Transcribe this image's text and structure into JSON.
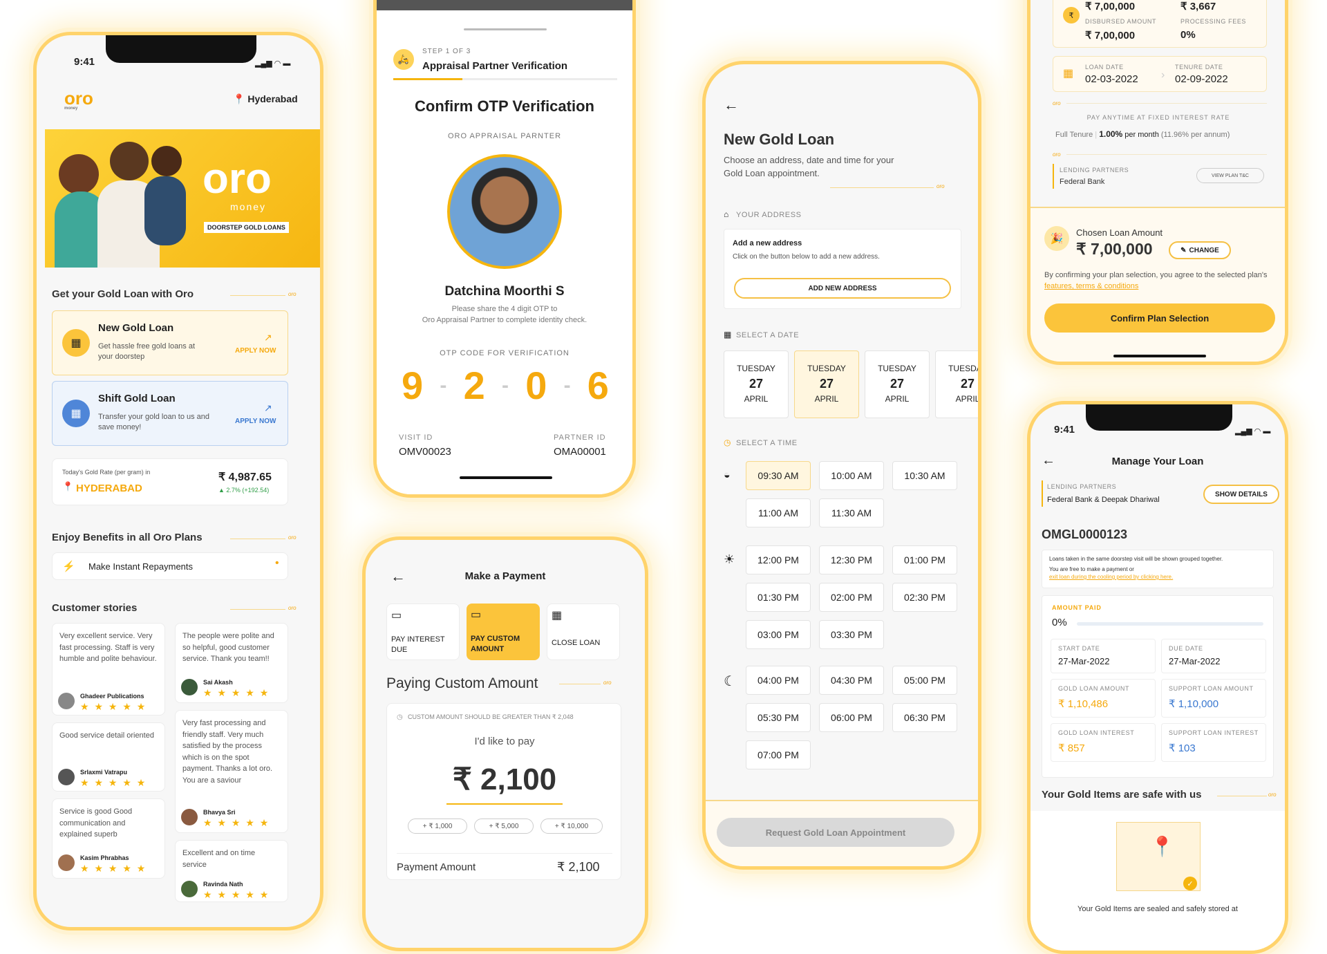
{
  "p1": {
    "time": "9:41",
    "location": "Hyderabad",
    "banner_brand": "oro",
    "banner_money": "money",
    "banner_tag": "DOORSTEP GOLD LOANS",
    "section1": "Get your Gold Loan with Oro",
    "new_loan": {
      "title": "New Gold Loan",
      "desc": "Get hassle free gold loans at your doorstep",
      "cta": "APPLY NOW"
    },
    "shift_loan": {
      "title": "Shift Gold Loan",
      "desc": "Transfer your gold loan to us and save money!",
      "cta": "APPLY NOW"
    },
    "rate": {
      "label": "Today's Gold Rate (per gram) in",
      "city": "HYDERABAD",
      "value": "₹ 4,987.65",
      "change": "▲ 2.7% (+192.54)"
    },
    "section2": "Enjoy Benefits in all Oro Plans",
    "benefit": "Make Instant Repayments",
    "section3": "Customer stories",
    "oro_tag": "oro",
    "stories_left": [
      {
        "text": "Very excellent service. Very fast processing. Staff is very humble and polite behaviour.",
        "name": "Ghadeer Publications"
      },
      {
        "text": "Good service detail oriented",
        "name": "Srlaxmi Vatrapu"
      },
      {
        "text": "Service is good Good communication and explained superb",
        "name": "Kasim Phrabhas"
      }
    ],
    "stories_right": [
      {
        "text": "The people were polite and so helpful, good customer service. Thank you team!!",
        "name": "Sai Akash"
      },
      {
        "text": "Very fast processing and friendly staff. Very much satisfied by the process which is on the spot payment. Thanks a lot oro. You are a saviour",
        "name": "Bhavya Sri"
      },
      {
        "text": "Excellent and on time service",
        "name": "Ravinda Nath"
      }
    ],
    "stars": "★ ★ ★ ★ ★"
  },
  "p2": {
    "step": "STEP 1 OF 3",
    "step_title": "Appraisal Partner Verification",
    "title": "Confirm OTP Verification",
    "subtitle": "ORO APPRAISAL PARNTER",
    "name": "Datchina Moorthi S",
    "desc1": "Please share the 4 digit OTP to",
    "desc2": "Oro Appraisal Partner to complete identity check.",
    "otp_label": "OTP CODE FOR VERIFICATION",
    "otp": [
      "9",
      "2",
      "0",
      "6"
    ],
    "visit_label": "VISIT ID",
    "visit_id": "OMV00023",
    "partner_label": "PARTNER ID",
    "partner_id": "OMA00001"
  },
  "p3": {
    "title": "Make a Payment",
    "options": [
      "PAY INTEREST DUE",
      "PAY CUSTOM AMOUNT",
      "CLOSE LOAN"
    ],
    "heading": "Paying Custom Amount",
    "oro_tag": "oro",
    "note": "CUSTOM AMOUNT SHOULD BE GREATER THAN ₹ 2,048",
    "like": "I'd like to pay",
    "amount": "₹ 2,100",
    "adds": [
      "+ ₹ 1,000",
      "+ ₹ 5,000",
      "+ ₹ 10,000"
    ],
    "pay_label": "Payment Amount",
    "pay_value": "₹ 2,100"
  },
  "p4": {
    "title": "New Gold Loan",
    "desc": "Choose an address, date and time for your Gold Loan appointment.",
    "oro_tag": "oro",
    "address_label": "YOUR ADDRESS",
    "add_title": "Add a new address",
    "add_desc": "Click on the button below to add a new address.",
    "add_btn": "ADD NEW ADDRESS",
    "date_label": "SELECT A DATE",
    "dates": [
      {
        "day": "TUESDAY",
        "num": "27",
        "month": "APRIL"
      },
      {
        "day": "TUESDAY",
        "num": "27",
        "month": "APRIL"
      },
      {
        "day": "TUESDAY",
        "num": "27",
        "month": "APRIL"
      },
      {
        "day": "TUESDAY",
        "num": "27",
        "month": "APRIL"
      }
    ],
    "time_label": "SELECT A TIME",
    "morning": [
      "09:30 AM",
      "10:00 AM",
      "10:30 AM",
      "11:00 AM",
      "11:30 AM"
    ],
    "afternoon": [
      "12:00 PM",
      "12:30 PM",
      "01:00 PM",
      "01:30 PM",
      "02:00 PM",
      "02:30 PM",
      "03:00 PM",
      "03:30 PM"
    ],
    "evening": [
      "04:00 PM",
      "04:30 PM",
      "05:00 PM",
      "05:30 PM",
      "06:00 PM",
      "06:30 PM",
      "07:00 PM"
    ],
    "request_btn": "Request Gold Loan Appointment"
  },
  "p5": {
    "top_amount": "₹ 7,00,000",
    "top_fees": "₹ 3,667",
    "disbursed_label": "DISBURSED AMOUNT",
    "disbursed": "₹ 7,00,000",
    "fees_label": "PROCESSING FEES",
    "fees": "0%",
    "loan_date_label": "LOAN DATE",
    "loan_date": "02-03-2022",
    "tenure_label": "TENURE DATE",
    "tenure_date": "02-09-2022",
    "oro_tag": "oro",
    "pay_anytime": "PAY ANYTIME AT FIXED INTEREST RATE",
    "full_tenure": "Full Tenure",
    "rate": "1.00%",
    "rate_suffix": "per month",
    "rate_annum": "(11.96% per annum)",
    "lending_label": "LENDING PARTNERS",
    "lending": "Federal Bank",
    "view_btn": "VIEW PLAN T&C",
    "chosen_label": "Chosen Loan Amount",
    "chosen": "₹ 7,00,000",
    "change": "CHANGE",
    "agree1": "By confirming your plan selection, you agree to the selected",
    "agree2": "plan's",
    "agree_link": "features, terms & conditions",
    "confirm_btn": "Confirm Plan Selection"
  },
  "p6": {
    "time": "9:41",
    "title": "Manage Your Loan",
    "lending_label": "LENDING PARTNERS",
    "lending": "Federal Bank & Deepak Dhariwal",
    "show_btn": "SHOW DETAILS",
    "loan_id": "OMGL0000123",
    "info1": "Loans taken in the same doorstep visit will be shown grouped together.",
    "info2": "You are free to make a payment or",
    "info_link": "exit loan during the cooling period by clicking here.",
    "paid_label": "AMOUNT PAID",
    "paid": "0%",
    "start_label": "START DATE",
    "start": "27-Mar-2022",
    "due_label": "DUE DATE",
    "due": "27-Mar-2022",
    "gold_amt_label": "GOLD LOAN AMOUNT",
    "gold_amt": "₹ 1,10,486",
    "support_amt_label": "SUPPORT LOAN AMOUNT",
    "support_amt": "₹ 1,10,000",
    "gold_int_label": "GOLD LOAN INTEREST",
    "gold_int": "₹ 857",
    "support_int_label": "SUPPORT LOAN INTEREST",
    "support_int": "₹ 103",
    "safe_title": "Your Gold Items are safe with us",
    "oro_tag": "oro",
    "safe_desc": "Your Gold Items are sealed and safely stored at"
  }
}
